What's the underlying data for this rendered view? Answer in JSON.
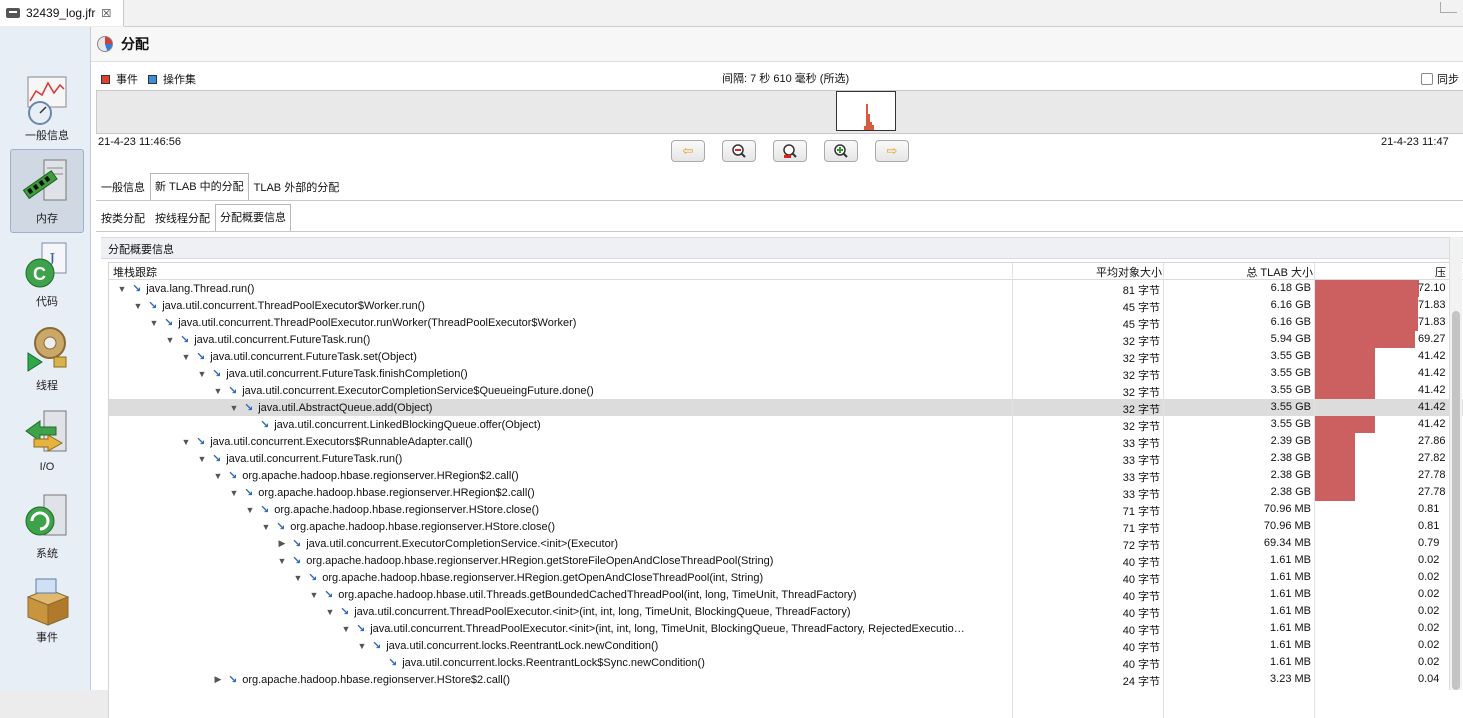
{
  "editor_tab": {
    "label": "32439_log.jfr",
    "close": "☒"
  },
  "sidebar": [
    {
      "label": "一般信息",
      "icon": "chart-gauge-icon"
    },
    {
      "label": "内存",
      "icon": "memory-server-icon",
      "selected": true
    },
    {
      "label": "代码",
      "icon": "java-code-icon"
    },
    {
      "label": "线程",
      "icon": "thread-gears-icon"
    },
    {
      "label": "I/O",
      "icon": "io-arrows-icon"
    },
    {
      "label": "系统",
      "icon": "system-server-icon"
    },
    {
      "label": "事件",
      "icon": "event-box-icon"
    }
  ],
  "page": {
    "title": "分配"
  },
  "legend": {
    "events": "事件",
    "operation_set": "操作集",
    "events_color": "#e04030",
    "operation_set_color": "#3a8fd8"
  },
  "interval": "间隔: 7 秒 610 毫秒 (所选)",
  "sync_label": "同步",
  "time_start": "21-4-23 11:46:56",
  "time_end": "21-4-23 11:47",
  "toolbar": [
    "arrow-left-icon",
    "zoom-out-icon",
    "zoom-fit-icon",
    "zoom-in-icon",
    "arrow-right-icon"
  ],
  "tabs_main": [
    "一般信息",
    "新 TLAB 中的分配",
    "TLAB 外部的分配"
  ],
  "tabs_sub": [
    "按类分配",
    "按线程分配",
    "分配概要信息"
  ],
  "section_title": "分配概要信息",
  "columns": {
    "stack": "堆栈跟踪",
    "avg": "平均对象大小",
    "total": "总 TLAB 大小",
    "pct": "压"
  },
  "rows": [
    {
      "depth": 0,
      "toggle": "▼",
      "label": "java.lang.Thread.run()",
      "avg": "81 字节",
      "total": "6.18 GB",
      "pct": "72.10",
      "pct_value": 72.1
    },
    {
      "depth": 1,
      "toggle": "▼",
      "label": "java.util.concurrent.ThreadPoolExecutor$Worker.run()",
      "avg": "45 字节",
      "total": "6.16 GB",
      "pct": "71.83",
      "pct_value": 71.83
    },
    {
      "depth": 2,
      "toggle": "▼",
      "label": "java.util.concurrent.ThreadPoolExecutor.runWorker(ThreadPoolExecutor$Worker)",
      "avg": "45 字节",
      "total": "6.16 GB",
      "pct": "71.83",
      "pct_value": 71.83
    },
    {
      "depth": 3,
      "toggle": "▼",
      "label": "java.util.concurrent.FutureTask.run()",
      "avg": "32 字节",
      "total": "5.94 GB",
      "pct": "69.27",
      "pct_value": 69.27
    },
    {
      "depth": 4,
      "toggle": "▼",
      "label": "java.util.concurrent.FutureTask.set(Object)",
      "avg": "32 字节",
      "total": "3.55 GB",
      "pct": "41.42",
      "pct_value": 41.42
    },
    {
      "depth": 5,
      "toggle": "▼",
      "label": "java.util.concurrent.FutureTask.finishCompletion()",
      "avg": "32 字节",
      "total": "3.55 GB",
      "pct": "41.42",
      "pct_value": 41.42
    },
    {
      "depth": 6,
      "toggle": "▼",
      "label": "java.util.concurrent.ExecutorCompletionService$QueueingFuture.done()",
      "avg": "32 字节",
      "total": "3.55 GB",
      "pct": "41.42",
      "pct_value": 41.42
    },
    {
      "depth": 7,
      "toggle": "▼",
      "label": "java.util.AbstractQueue.add(Object)",
      "avg": "32 字节",
      "total": "3.55 GB",
      "pct": "41.42",
      "pct_value": 41.42,
      "selected": true
    },
    {
      "depth": 8,
      "toggle": "",
      "label": "java.util.concurrent.LinkedBlockingQueue.offer(Object)",
      "avg": "32 字节",
      "total": "3.55 GB",
      "pct": "41.42",
      "pct_value": 41.42
    },
    {
      "depth": 4,
      "toggle": "▼",
      "label": "java.util.concurrent.Executors$RunnableAdapter.call()",
      "avg": "33 字节",
      "total": "2.39 GB",
      "pct": "27.86",
      "pct_value": 27.86
    },
    {
      "depth": 5,
      "toggle": "▼",
      "label": "java.util.concurrent.FutureTask.run()",
      "avg": "33 字节",
      "total": "2.38 GB",
      "pct": "27.82",
      "pct_value": 27.82
    },
    {
      "depth": 6,
      "toggle": "▼",
      "label": "org.apache.hadoop.hbase.regionserver.HRegion$2.call()",
      "avg": "33 字节",
      "total": "2.38 GB",
      "pct": "27.78",
      "pct_value": 27.78
    },
    {
      "depth": 7,
      "toggle": "▼",
      "label": "org.apache.hadoop.hbase.regionserver.HRegion$2.call()",
      "avg": "33 字节",
      "total": "2.38 GB",
      "pct": "27.78",
      "pct_value": 27.78
    },
    {
      "depth": 8,
      "toggle": "▼",
      "label": "org.apache.hadoop.hbase.regionserver.HStore.close()",
      "avg": "71 字节",
      "total": "70.96 MB",
      "pct": "0.81",
      "pct_value": 0.81
    },
    {
      "depth": 9,
      "toggle": "▼",
      "label": "org.apache.hadoop.hbase.regionserver.HStore.close()",
      "avg": "71 字节",
      "total": "70.96 MB",
      "pct": "0.81",
      "pct_value": 0.81
    },
    {
      "depth": 10,
      "toggle": "▶",
      "label": "java.util.concurrent.ExecutorCompletionService.<init>(Executor)",
      "avg": "72 字节",
      "total": "69.34 MB",
      "pct": "0.79",
      "pct_value": 0.79
    },
    {
      "depth": 10,
      "toggle": "▼",
      "label": "org.apache.hadoop.hbase.regionserver.HRegion.getStoreFileOpenAndCloseThreadPool(String)",
      "avg": "40 字节",
      "total": "1.61 MB",
      "pct": "0.02",
      "pct_value": 0.02
    },
    {
      "depth": 11,
      "toggle": "▼",
      "label": "org.apache.hadoop.hbase.regionserver.HRegion.getOpenAndCloseThreadPool(int, String)",
      "avg": "40 字节",
      "total": "1.61 MB",
      "pct": "0.02",
      "pct_value": 0.02
    },
    {
      "depth": 12,
      "toggle": "▼",
      "label": "org.apache.hadoop.hbase.util.Threads.getBoundedCachedThreadPool(int, long, TimeUnit, ThreadFactory)",
      "avg": "40 字节",
      "total": "1.61 MB",
      "pct": "0.02",
      "pct_value": 0.02
    },
    {
      "depth": 13,
      "toggle": "▼",
      "label": "java.util.concurrent.ThreadPoolExecutor.<init>(int, int, long, TimeUnit, BlockingQueue, ThreadFactory)",
      "avg": "40 字节",
      "total": "1.61 MB",
      "pct": "0.02",
      "pct_value": 0.02
    },
    {
      "depth": 14,
      "toggle": "▼",
      "label": "java.util.concurrent.ThreadPoolExecutor.<init>(int, int, long, TimeUnit, BlockingQueue, ThreadFactory, RejectedExecutio…",
      "avg": "40 字节",
      "total": "1.61 MB",
      "pct": "0.02",
      "pct_value": 0.02
    },
    {
      "depth": 15,
      "toggle": "▼",
      "label": "java.util.concurrent.locks.ReentrantLock.newCondition()",
      "avg": "40 字节",
      "total": "1.61 MB",
      "pct": "0.02",
      "pct_value": 0.02
    },
    {
      "depth": 16,
      "toggle": "",
      "label": "java.util.concurrent.locks.ReentrantLock$Sync.newCondition()",
      "avg": "40 字节",
      "total": "1.61 MB",
      "pct": "0.02",
      "pct_value": 0.02
    },
    {
      "depth": 6,
      "toggle": "▶",
      "label": "org.apache.hadoop.hbase.regionserver.HStore$2.call()",
      "avg": "24 字节",
      "total": "3.23 MB",
      "pct": "0.04",
      "pct_value": 0.04
    }
  ]
}
